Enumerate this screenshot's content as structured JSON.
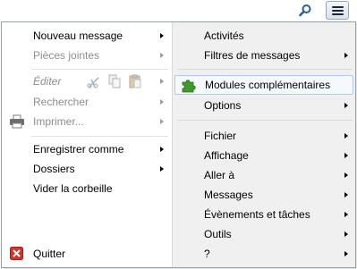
{
  "toolbar": {
    "search_icon": "magnifier-icon",
    "menu_icon": "hamburger-menu-icon"
  },
  "left_menu": {
    "items": [
      {
        "label": "Nouveau message",
        "has_submenu": true
      },
      {
        "label": "Pièces jointes",
        "has_submenu": true,
        "disabled": true
      },
      {
        "label": "Éditer",
        "has_submenu": true,
        "disabled": true,
        "icons": [
          "cut-icon",
          "copy-icon",
          "paste-icon"
        ]
      },
      {
        "label": "Rechercher",
        "has_submenu": true,
        "disabled": true
      },
      {
        "label": "Imprimer...",
        "has_submenu": true,
        "disabled": true,
        "icon": "printer-icon"
      },
      {
        "label": "Enregistrer comme",
        "has_submenu": true
      },
      {
        "label": "Dossiers",
        "has_submenu": true
      },
      {
        "label": "Vider la corbeille",
        "has_submenu": false
      },
      {
        "label": "Quitter",
        "has_submenu": false,
        "icon": "quit-icon"
      }
    ]
  },
  "right_menu": {
    "items": [
      {
        "label": "Activités",
        "has_submenu": false
      },
      {
        "label": "Filtres de messages",
        "has_submenu": true
      },
      {
        "label": "Modules complémentaires",
        "has_submenu": false,
        "highlighted": true,
        "icon": "puzzle-piece-icon"
      },
      {
        "label": "Options",
        "has_submenu": true
      },
      {
        "label": "Fichier",
        "has_submenu": true
      },
      {
        "label": "Affichage",
        "has_submenu": true
      },
      {
        "label": "Aller à",
        "has_submenu": true
      },
      {
        "label": "Messages",
        "has_submenu": true
      },
      {
        "label": "Évènements et tâches",
        "has_submenu": true
      },
      {
        "label": "Outils",
        "has_submenu": true
      },
      {
        "label": "?",
        "has_submenu": true
      }
    ]
  },
  "colors": {
    "highlight_border": "#aecbee",
    "highlight_fill": "#f5f9fe",
    "disabled_text": "#8d8d8d",
    "quit_icon": "#d9302c",
    "puzzle_icon": "#3f9a2e"
  }
}
